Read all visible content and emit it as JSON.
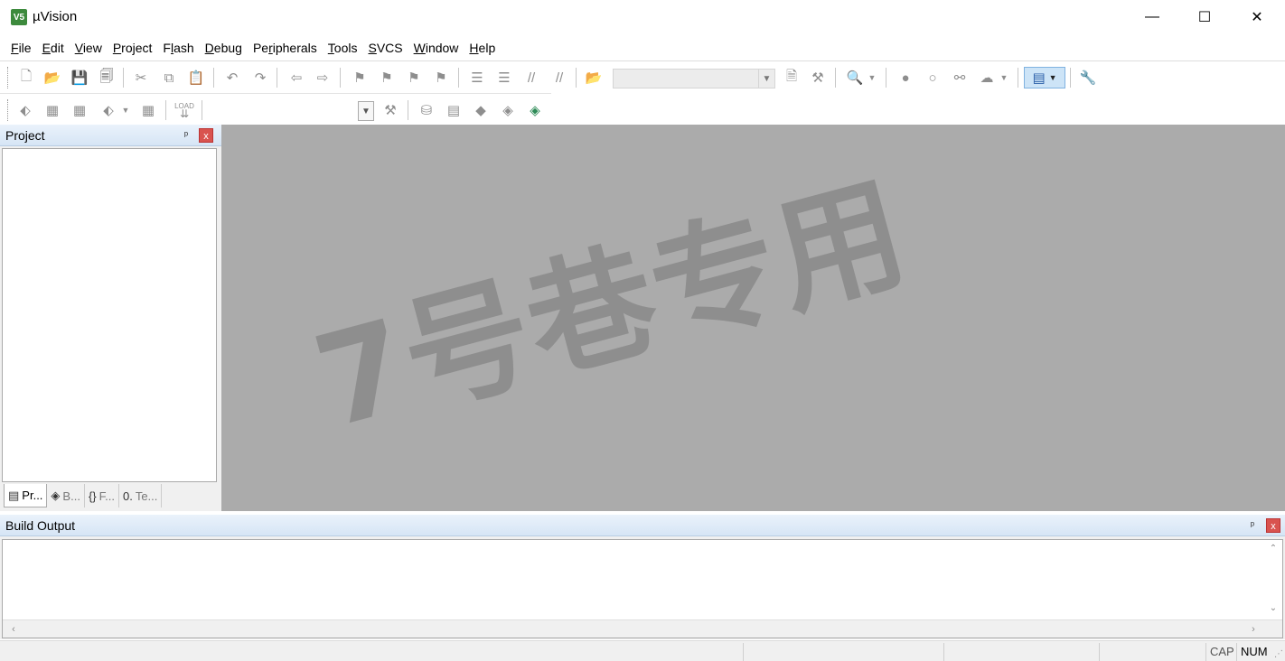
{
  "window": {
    "title": "µVision",
    "app_icon": "keil-v5-icon",
    "minimize": "—",
    "maximize": "☐",
    "close": "✕"
  },
  "menu": [
    {
      "label": "File",
      "mnemonic": "F",
      "rest": "ile"
    },
    {
      "label": "Edit",
      "mnemonic": "E",
      "rest": "dit"
    },
    {
      "label": "View",
      "mnemonic": "V",
      "rest": "iew"
    },
    {
      "label": "Project",
      "mnemonic": "P",
      "rest": "roject"
    },
    {
      "label": "Flash",
      "pre": "F",
      "mnemonic": "l",
      "rest": "ash"
    },
    {
      "label": "Debug",
      "mnemonic": "D",
      "rest": "ebug"
    },
    {
      "label": "Peripherals",
      "pre": "Pe",
      "mnemonic": "r",
      "rest": "ipherals"
    },
    {
      "label": "Tools",
      "mnemonic": "T",
      "rest": "ools"
    },
    {
      "label": "SVCS",
      "mnemonic": "S",
      "rest": "VCS"
    },
    {
      "label": "Window",
      "mnemonic": "W",
      "rest": "indow"
    },
    {
      "label": "Help",
      "mnemonic": "H",
      "rest": "elp"
    }
  ],
  "toolbar": {
    "target_combo_value": "",
    "find_combo_value": "",
    "load_label": "LOAD"
  },
  "project_panel": {
    "title": "Project",
    "pin": "ᵖ",
    "close": "x",
    "tabs": [
      {
        "label": "Pr...",
        "icon": "project-tab-icon",
        "glyph": "▤"
      },
      {
        "label": "B...",
        "icon": "books-tab-icon",
        "glyph": "◈"
      },
      {
        "label": "F...",
        "icon": "functions-tab-icon",
        "glyph": "{}"
      },
      {
        "label": "Te...",
        "icon": "templates-tab-icon",
        "glyph": "0."
      }
    ]
  },
  "editor": {
    "watermark": "7号巷专用"
  },
  "build_output": {
    "title": "Build Output",
    "pin": "ᵖ",
    "close": "x",
    "text": ""
  },
  "statusbar": {
    "cap": "CAP",
    "num": "NUM"
  }
}
